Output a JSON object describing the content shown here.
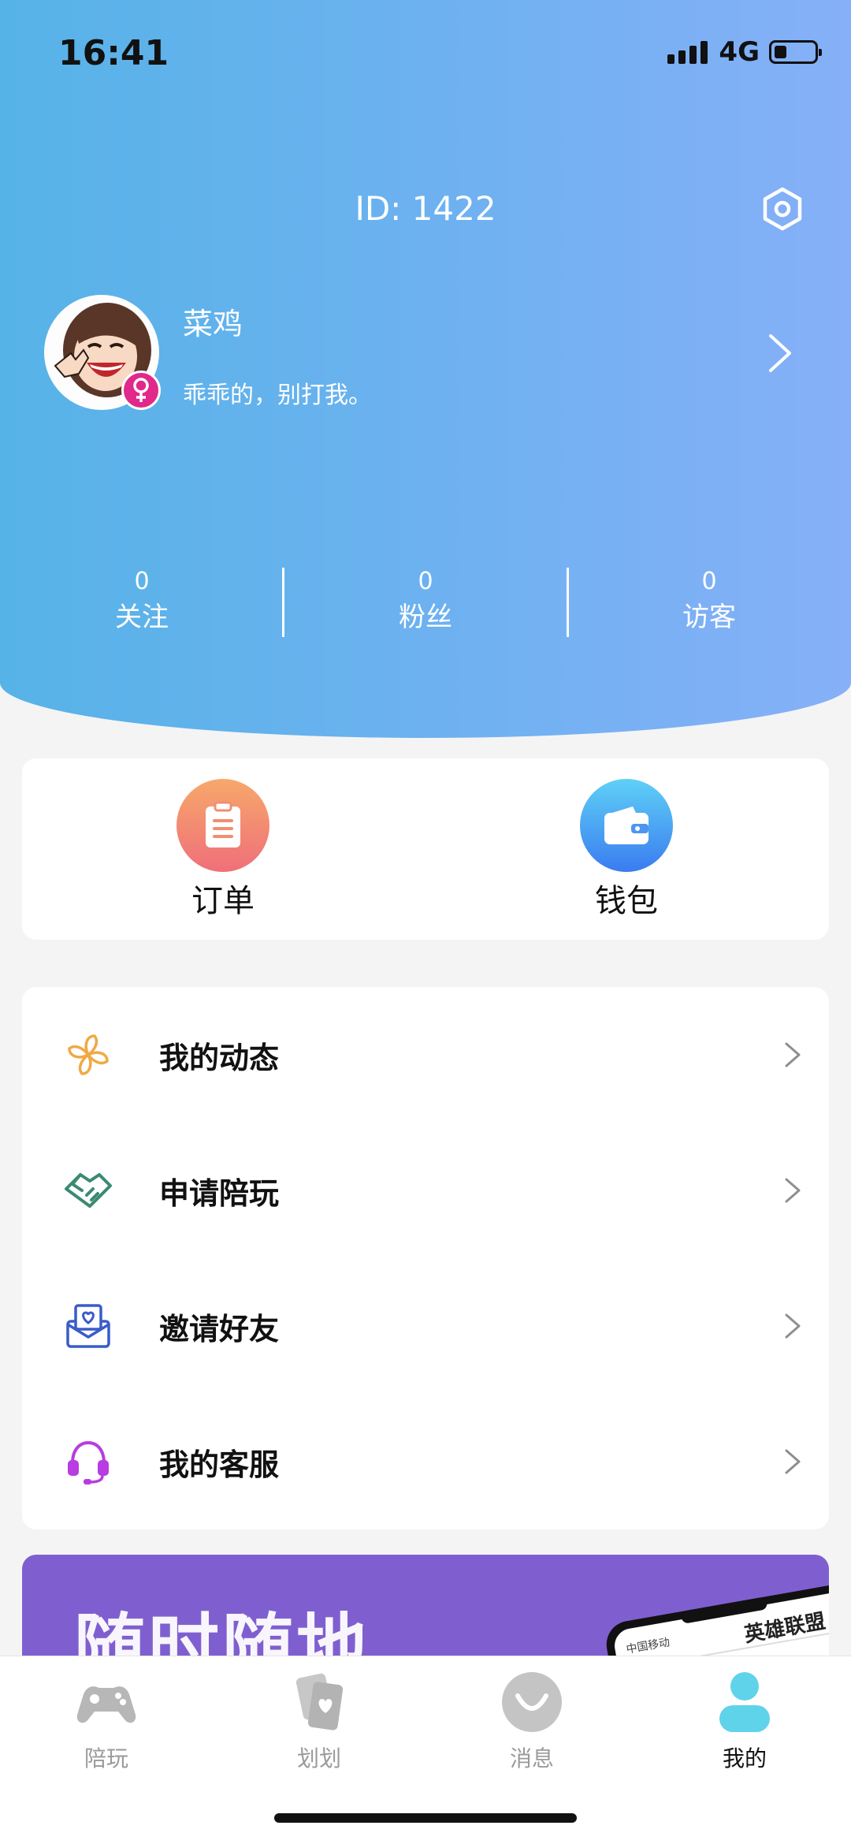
{
  "status_bar": {
    "time": "16:41",
    "network": "4G"
  },
  "header": {
    "id_text": "ID: 1422",
    "settings_icon": "hexagon-settings-icon",
    "gradient": [
      "#56b3e7",
      "#86b0f8"
    ]
  },
  "profile": {
    "name": "菜鸡",
    "signature": "乖乖的，别打我。",
    "gender": "female",
    "gender_color": "#e0298b"
  },
  "stats": [
    {
      "count": "0",
      "label": "关注"
    },
    {
      "count": "0",
      "label": "粉丝"
    },
    {
      "count": "0",
      "label": "访客"
    }
  ],
  "quick_actions": [
    {
      "label": "订单",
      "icon": "clipboard-icon",
      "colors": [
        "#f7a86a",
        "#ef6f7a"
      ]
    },
    {
      "label": "钱包",
      "icon": "wallet-icon",
      "colors": [
        "#5fd0f6",
        "#3a7cf0"
      ]
    }
  ],
  "menu": [
    {
      "label": "我的动态",
      "icon": "pinwheel-icon",
      "color": "#f0a944"
    },
    {
      "label": "申请陪玩",
      "icon": "handshake-icon",
      "color": "#3b8a73"
    },
    {
      "label": "邀请好友",
      "icon": "invite-envelope-icon",
      "color": "#3a5cc9"
    },
    {
      "label": "我的客服",
      "icon": "headset-icon",
      "color": "#b73de0"
    }
  ],
  "banner": {
    "text": "随时随地",
    "phone_text": "英雄联盟",
    "phone_carrier": "中国移动",
    "color": "#7f5fd0"
  },
  "tabbar": {
    "tabs": [
      {
        "label": "陪玩",
        "icon": "gamepad-icon",
        "active": false
      },
      {
        "label": "划划",
        "icon": "cards-icon",
        "active": false
      },
      {
        "label": "消息",
        "icon": "message-smile-icon",
        "active": false
      },
      {
        "label": "我的",
        "icon": "profile-icon",
        "active": true
      }
    ],
    "active_color": "#5fd3ea"
  }
}
